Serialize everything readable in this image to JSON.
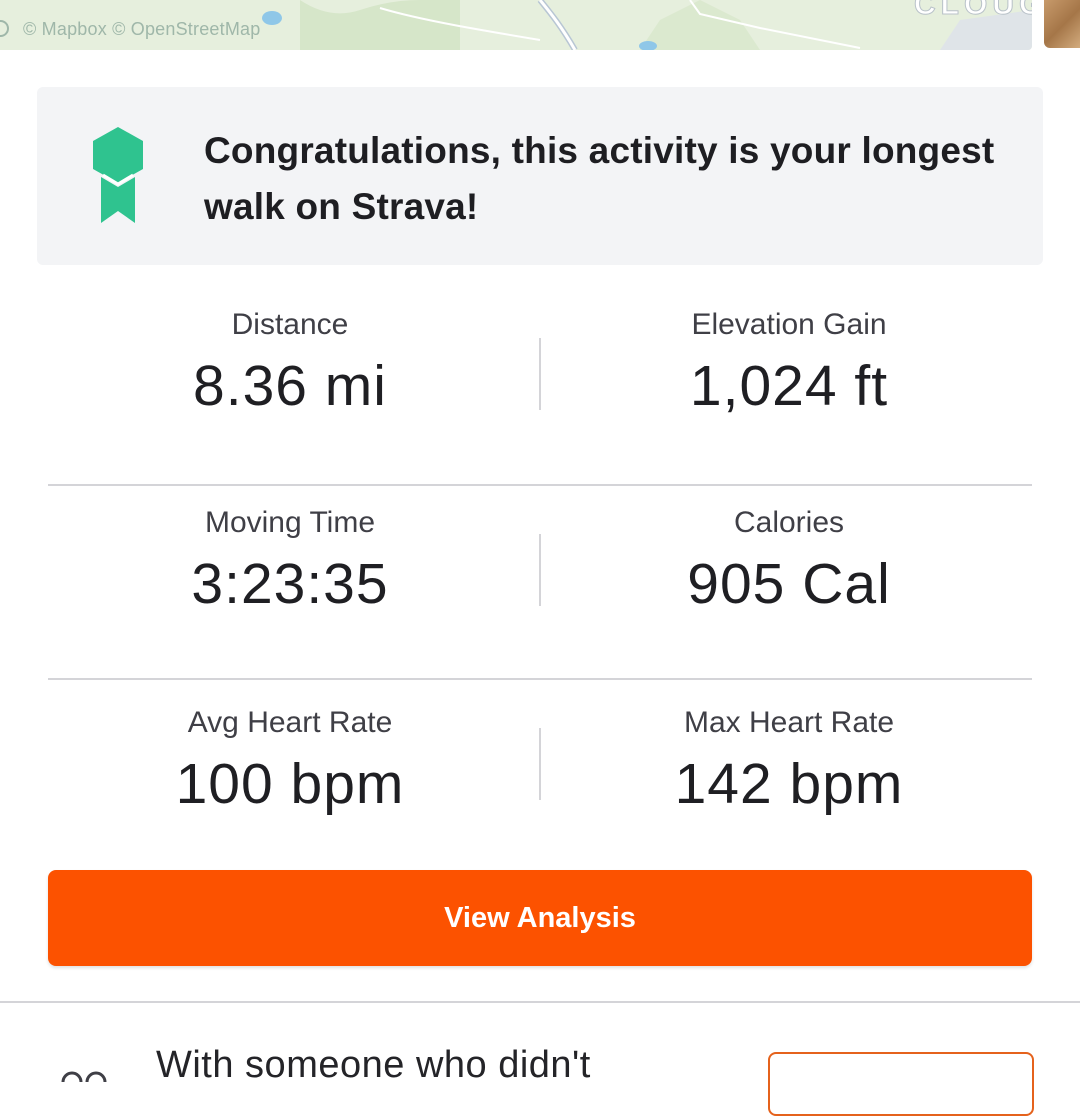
{
  "map": {
    "attribution": "© Mapbox © OpenStreetMap",
    "place_label": "CLOUG",
    "colors": {
      "land": "#e6efdd",
      "water": "#8fc7e8",
      "road": "#ffffff"
    }
  },
  "achievement": {
    "icon": "award-ribbon-icon",
    "icon_color": "#2fc38f",
    "message": "Congratulations, this activity is your longest walk on Strava!"
  },
  "stats": [
    {
      "label": "Distance",
      "value": "8.36 mi"
    },
    {
      "label": "Elevation Gain",
      "value": "1,024 ft"
    },
    {
      "label": "Moving Time",
      "value": "3:23:35"
    },
    {
      "label": "Calories",
      "value": "905 Cal"
    },
    {
      "label": "Avg Heart Rate",
      "value": "100 bpm"
    },
    {
      "label": "Max Heart Rate",
      "value": "142 bpm"
    }
  ],
  "actions": {
    "view_analysis": "View Analysis",
    "button_color": "#fc5200"
  },
  "partner_prompt": {
    "text": "With someone who didn't",
    "icon": "people-icon"
  }
}
